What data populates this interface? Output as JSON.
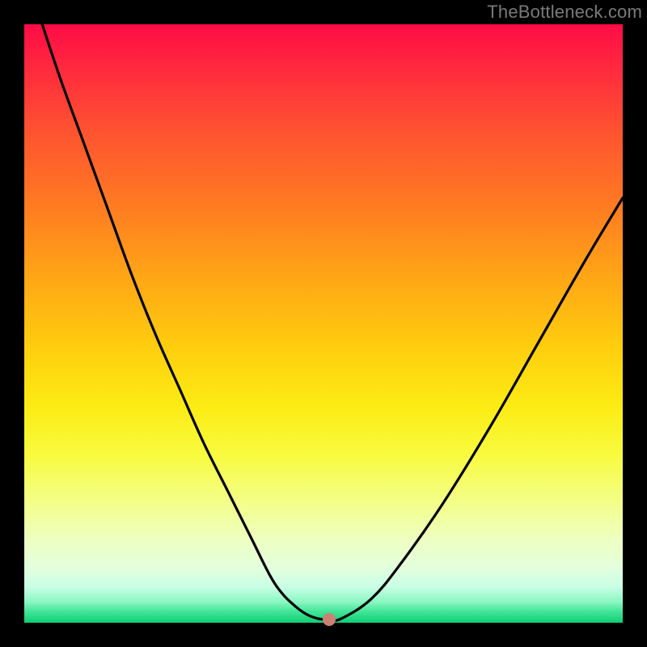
{
  "watermark": "TheBottleneck.com",
  "colors": {
    "frame": "#000000",
    "curve": "#000000",
    "dot": "#cc8073",
    "gradient_top": "#ff0b46",
    "gradient_bottom": "#0fce74"
  },
  "chart_data": {
    "type": "line",
    "title": "",
    "xlabel": "",
    "ylabel": "",
    "xlim": [
      0,
      100
    ],
    "ylim": [
      0,
      100
    ],
    "grid": false,
    "legend": false,
    "series": [
      {
        "name": "bottleneck-curve",
        "x": [
          3,
          6,
          10,
          14,
          18,
          22,
          26,
          30,
          34,
          38,
          41,
          43,
          45,
          47,
          49,
          51,
          53,
          58,
          63,
          70,
          78,
          86,
          94,
          100
        ],
        "y": [
          100,
          91,
          80,
          69,
          58,
          48,
          39,
          30,
          22,
          14,
          8,
          5,
          3,
          1.5,
          0.7,
          0.5,
          0.7,
          4,
          10,
          20,
          33,
          47,
          61,
          71
        ]
      }
    ],
    "marker": {
      "x": 51,
      "y": 0.5
    },
    "flat_minimum": {
      "x_start": 47,
      "x_end": 53,
      "y": 0.6
    }
  }
}
